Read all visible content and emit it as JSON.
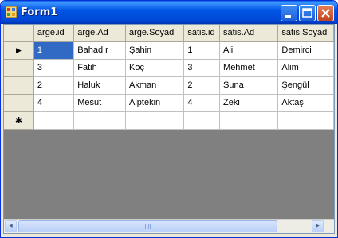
{
  "window": {
    "title": "Form1"
  },
  "grid": {
    "columns": [
      "arge.id",
      "arge.Ad",
      "arge.Soyad",
      "satis.id",
      "satis.Ad",
      "satis.Soyad"
    ],
    "rows": [
      [
        "1",
        "Bahadır",
        "Şahin",
        "1",
        "Ali",
        "Demirci"
      ],
      [
        "3",
        "Fatih",
        "Koç",
        "3",
        "Mehmet",
        "Alim"
      ],
      [
        "2",
        "Haluk",
        "Akman",
        "2",
        "Suna",
        "Şengül"
      ],
      [
        "4",
        "Mesut",
        "Alptekin",
        "4",
        "Zeki",
        "Aktaş"
      ]
    ],
    "current_row_glyph": "▶",
    "new_row_glyph": "✱"
  },
  "scrollbar": {
    "left_arrow": "◂",
    "right_arrow": "▸"
  },
  "colors": {
    "titlebar": "#0055e5",
    "selection": "#316ac5",
    "grid_background": "#808080"
  }
}
